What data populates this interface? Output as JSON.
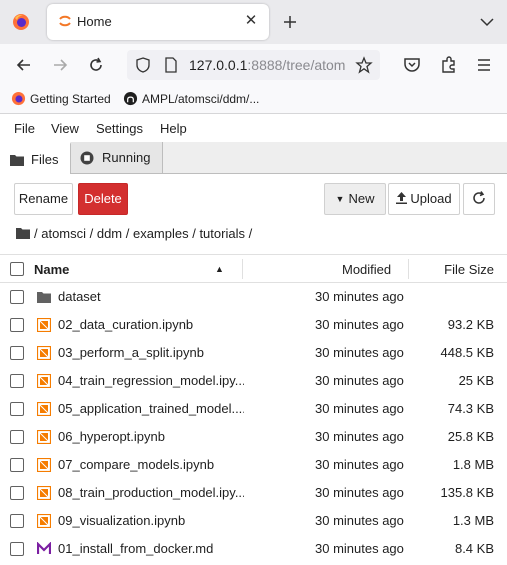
{
  "browser": {
    "tab_title": "Home",
    "url_host": "127.0.0.1",
    "url_rest": ":8888/tree/atom",
    "bookmarks": [
      "Getting Started",
      "AMPL/atomsci/ddm/..."
    ]
  },
  "menubar": [
    "File",
    "View",
    "Settings",
    "Help"
  ],
  "tabs": [
    "Files",
    "Running"
  ],
  "toolbar": {
    "rename": "Rename",
    "delete": "Delete",
    "new": "New",
    "upload": "Upload"
  },
  "breadcrumb": "/ atomsci / ddm / examples / tutorials /",
  "columns": {
    "name": "Name",
    "modified": "Modified",
    "size": "File Size"
  },
  "colors": {
    "delete": "#d32f2f",
    "notebook_icon": "#f57c00",
    "markdown_icon": "#7b1fa2",
    "folder_icon": "#616161"
  },
  "files": [
    {
      "icon": "folder-icon",
      "name": "dataset",
      "modified": "30 minutes ago",
      "size": ""
    },
    {
      "icon": "notebook-icon",
      "name": "02_data_curation.ipynb",
      "modified": "30 minutes ago",
      "size": "93.2 KB"
    },
    {
      "icon": "notebook-icon",
      "name": "03_perform_a_split.ipynb",
      "modified": "30 minutes ago",
      "size": "448.5 KB"
    },
    {
      "icon": "notebook-icon",
      "name": "04_train_regression_model.ipy...",
      "modified": "30 minutes ago",
      "size": "25 KB"
    },
    {
      "icon": "notebook-icon",
      "name": "05_application_trained_model....",
      "modified": "30 minutes ago",
      "size": "74.3 KB"
    },
    {
      "icon": "notebook-icon",
      "name": "06_hyperopt.ipynb",
      "modified": "30 minutes ago",
      "size": "25.8 KB"
    },
    {
      "icon": "notebook-icon",
      "name": "07_compare_models.ipynb",
      "modified": "30 minutes ago",
      "size": "1.8 MB"
    },
    {
      "icon": "notebook-icon",
      "name": "08_train_production_model.ipy...",
      "modified": "30 minutes ago",
      "size": "135.8 KB"
    },
    {
      "icon": "notebook-icon",
      "name": "09_visualization.ipynb",
      "modified": "30 minutes ago",
      "size": "1.3 MB"
    },
    {
      "icon": "markdown-icon",
      "name": "01_install_from_docker.md",
      "modified": "30 minutes ago",
      "size": "8.4 KB"
    }
  ]
}
